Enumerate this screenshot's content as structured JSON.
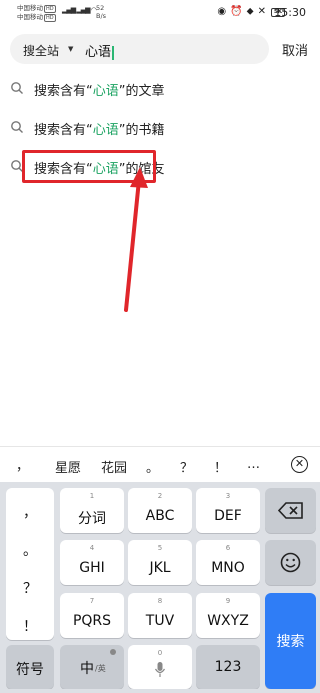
{
  "status_bar": {
    "carrier1": "中国移动",
    "carrier2": "中国移动",
    "hd": "HD",
    "net_speed_value": "52",
    "net_speed_unit": "B/s",
    "battery": "5K",
    "time": "15:30"
  },
  "search": {
    "scope_label": "搜全站",
    "query": "心语",
    "cancel_label": "取消"
  },
  "suggestions": [
    {
      "prefix": "搜索含有“",
      "keyword": "心语",
      "suffix": "”的文章"
    },
    {
      "prefix": "搜索含有“",
      "keyword": "心语",
      "suffix": "”的书籍"
    },
    {
      "prefix": "搜索含有“",
      "keyword": "心语",
      "suffix": "”的馆友"
    }
  ],
  "keyboard_candidates": {
    "comma": "，",
    "c1": "星愿",
    "c2": "花园",
    "c3": "。",
    "c4": "？",
    "c5": "！",
    "c6": "…"
  },
  "keyboard": {
    "punct": [
      "，",
      "。",
      "？",
      "！"
    ],
    "row1": [
      {
        "sub": "1",
        "main": "分词"
      },
      {
        "sub": "2",
        "main": "ABC"
      },
      {
        "sub": "3",
        "main": "DEF"
      }
    ],
    "row2": [
      {
        "sub": "4",
        "main": "GHI"
      },
      {
        "sub": "5",
        "main": "JKL"
      },
      {
        "sub": "6",
        "main": "MNO"
      }
    ],
    "row3": [
      {
        "sub": "7",
        "main": "PQRS"
      },
      {
        "sub": "8",
        "main": "TUV"
      },
      {
        "sub": "9",
        "main": "WXYZ"
      }
    ],
    "symbols_label": "符号",
    "lang_main": "中",
    "lang_sub": "/英",
    "space_sub": "0",
    "numbers_label": "123",
    "search_label": "搜索"
  },
  "colors": {
    "highlight": "#1aa260",
    "annotation": "#e0262b",
    "search_key": "#2f7df6"
  }
}
